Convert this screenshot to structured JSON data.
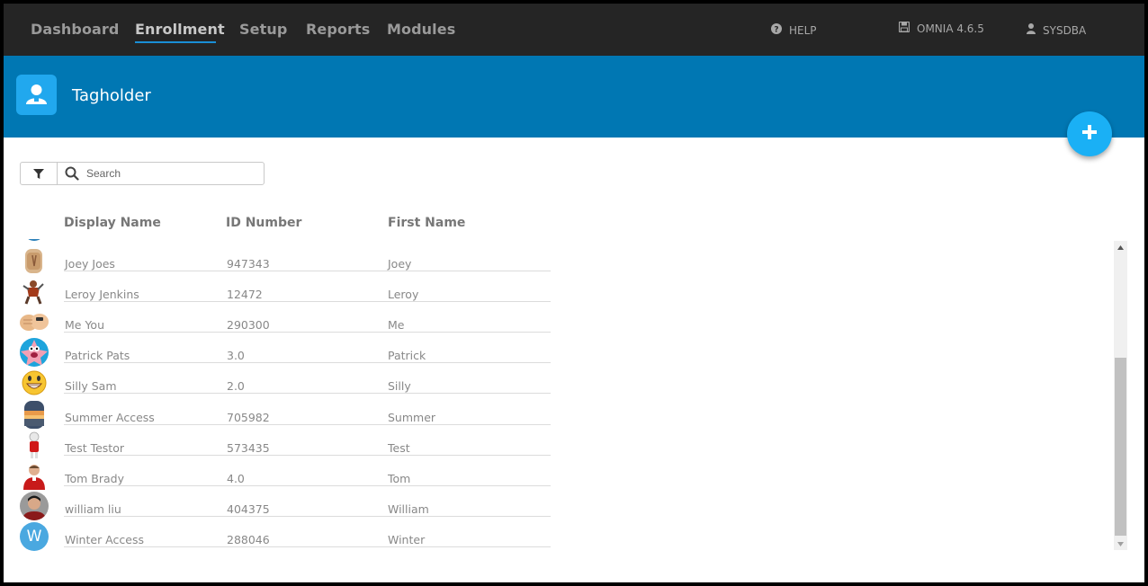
{
  "nav": {
    "items": [
      "Dashboard",
      "Enrollment",
      "Setup",
      "Reports",
      "Modules"
    ],
    "active": "Enrollment",
    "help": "HELP",
    "version": "OMNIA 4.6.5",
    "user": "SYSDBA"
  },
  "header": {
    "title": "Tagholder",
    "add_icon": "plus-icon"
  },
  "search": {
    "placeholder": "Search",
    "value": "",
    "filter_icon": "funnel-icon"
  },
  "table": {
    "columns": [
      "Display Name",
      "ID Number",
      "First Name"
    ],
    "rows": [
      {
        "display_name": "Joey Joes",
        "id_number": "947343",
        "first_name": "Joey",
        "avatar": "bottle-photo"
      },
      {
        "display_name": "Leroy Jenkins",
        "id_number": "12472",
        "first_name": "Leroy",
        "avatar": "warrior-photo"
      },
      {
        "display_name": "Me You",
        "id_number": "290300",
        "first_name": "Me",
        "avatar": "fist-bump-photo"
      },
      {
        "display_name": "Patrick Pats",
        "id_number": "3.0",
        "first_name": "Patrick",
        "avatar": "starfish-cartoon"
      },
      {
        "display_name": "Silly Sam",
        "id_number": "2.0",
        "first_name": "Silly",
        "avatar": "grinning-emoji"
      },
      {
        "display_name": "Summer Access",
        "id_number": "705982",
        "first_name": "Summer",
        "avatar": "sunset-photo"
      },
      {
        "display_name": "Test Testor",
        "id_number": "573435",
        "first_name": "Test",
        "avatar": "figure-photo"
      },
      {
        "display_name": "Tom Brady",
        "id_number": "4.0",
        "first_name": "Tom",
        "avatar": "person-photo"
      },
      {
        "display_name": "william liu",
        "id_number": "404375",
        "first_name": "William",
        "avatar": "person-photo"
      },
      {
        "display_name": "Winter Access",
        "id_number": "288046",
        "first_name": "Winter",
        "avatar": "letter-w",
        "avatar_letter": "W"
      }
    ]
  },
  "colors": {
    "nav_bg": "#252525",
    "band_bg": "#0077b3",
    "accent": "#1ab0f5",
    "active_underline": "#1a8fd6"
  }
}
